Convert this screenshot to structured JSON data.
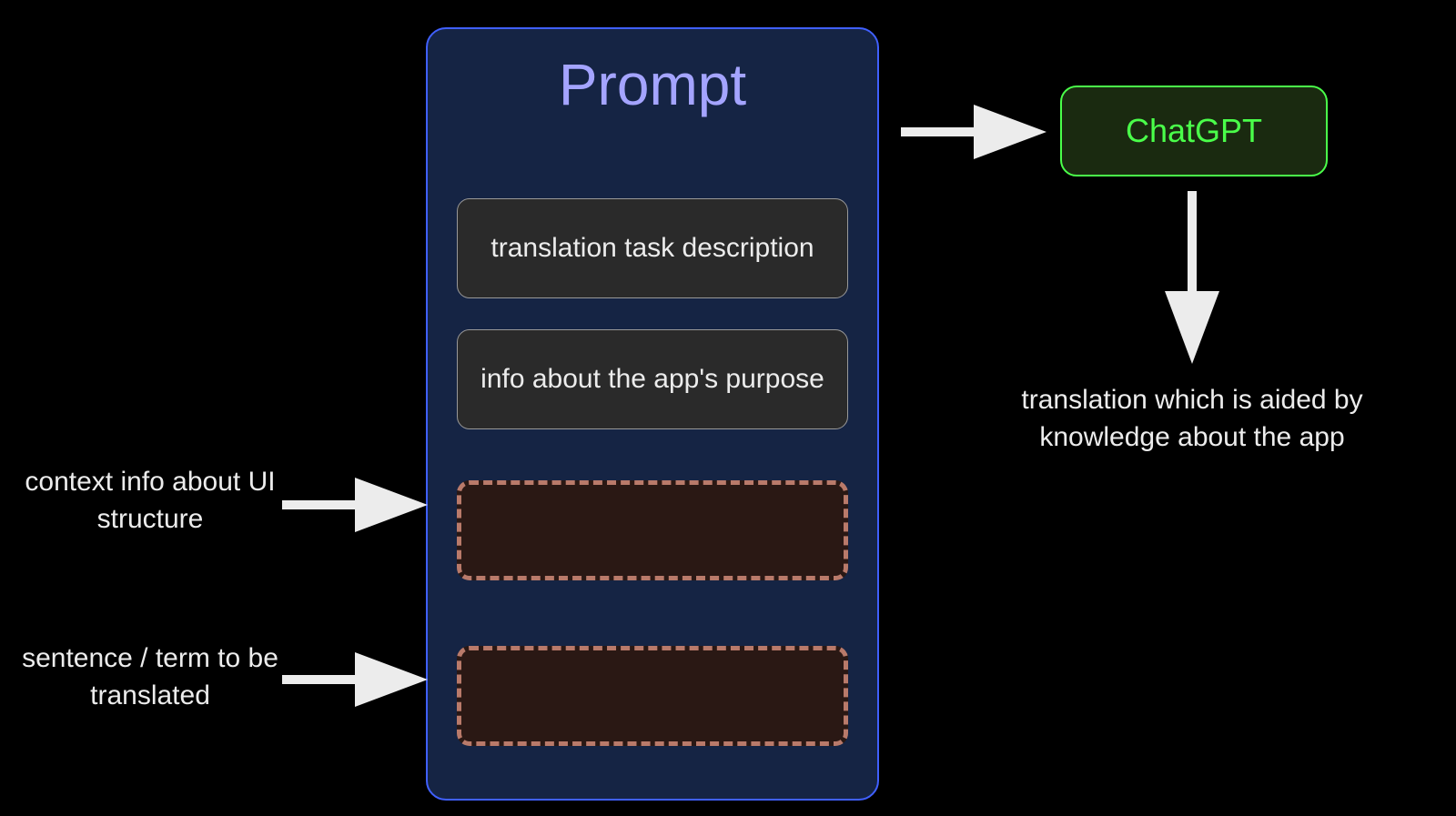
{
  "prompt": {
    "title": "Prompt",
    "subbox1": "translation task description",
    "subbox2": "info about the app's purpose"
  },
  "labels": {
    "left1": "context info about UI structure",
    "left2": "sentence / term to be translated",
    "right": "translation which is aided by knowledge about the app"
  },
  "chatgpt": {
    "label": "ChatGPT"
  },
  "colors": {
    "background": "#000000",
    "prompt_fill": "#152444",
    "prompt_border": "#4060ff",
    "prompt_title": "#a4a4ff",
    "subbox_fill": "#2a2a2a",
    "subbox_border": "#999999",
    "dash_fill": "#2a1814",
    "dash_border": "#b97a6a",
    "chatgpt_fill": "#1a2a10",
    "chatgpt_border": "#4aff4a",
    "text": "#ececec",
    "arrow": "#ececec"
  }
}
